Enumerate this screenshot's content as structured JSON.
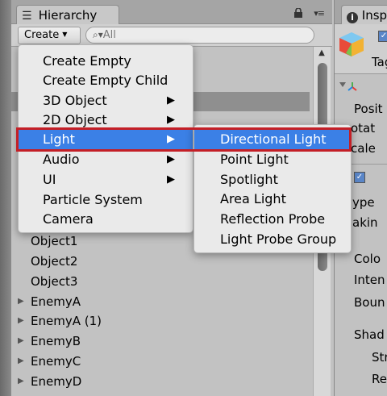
{
  "hierarchy": {
    "tab_title": "Hierarchy",
    "create_label": "Create",
    "search_placeholder": "All",
    "rows": [
      {
        "label": "Object1",
        "has_arrow": false
      },
      {
        "label": "Object2",
        "has_arrow": false
      },
      {
        "label": "Object3",
        "has_arrow": false
      },
      {
        "label": "EnemyA",
        "has_arrow": true
      },
      {
        "label": "EnemyA (1)",
        "has_arrow": true
      },
      {
        "label": "EnemyB",
        "has_arrow": true
      },
      {
        "label": "EnemyC",
        "has_arrow": true
      },
      {
        "label": "EnemyD",
        "has_arrow": true
      }
    ]
  },
  "create_menu": {
    "items": [
      {
        "label": "Create Empty",
        "submenu": false
      },
      {
        "label": "Create Empty Child",
        "submenu": false
      },
      {
        "label": "3D Object",
        "submenu": true
      },
      {
        "label": "2D Object",
        "submenu": true
      },
      {
        "label": "Light",
        "submenu": true,
        "active": true
      },
      {
        "label": "Audio",
        "submenu": true
      },
      {
        "label": "UI",
        "submenu": true
      },
      {
        "label": "Particle System",
        "submenu": false
      },
      {
        "label": "Camera",
        "submenu": false
      }
    ]
  },
  "light_submenu": {
    "items": [
      {
        "label": "Directional Light",
        "active": true
      },
      {
        "label": "Point Light"
      },
      {
        "label": "Spotlight"
      },
      {
        "label": "Area Light"
      },
      {
        "label": "Reflection Probe"
      },
      {
        "label": "Light Probe Group"
      }
    ]
  },
  "inspector": {
    "tab_title": "Insp",
    "tag_label": "Tag",
    "labels": [
      "Posit",
      "otat",
      "cale",
      "ype",
      "akin",
      "Colo",
      "Inten",
      "Boun",
      "Shad",
      "Str",
      "Re"
    ]
  },
  "colors": {
    "menu_highlight": "#3b80e6",
    "callout_border": "#c41f26"
  },
  "icons": {
    "hierarchy": "list-icon",
    "lock": "lock-icon",
    "panel_menu": "panel-menu-icon",
    "search": "search-icon",
    "submenu": "submenu-arrow-icon",
    "expand": "expand-arrow-icon",
    "info": "info-icon",
    "gameobject": "cube-icon"
  }
}
